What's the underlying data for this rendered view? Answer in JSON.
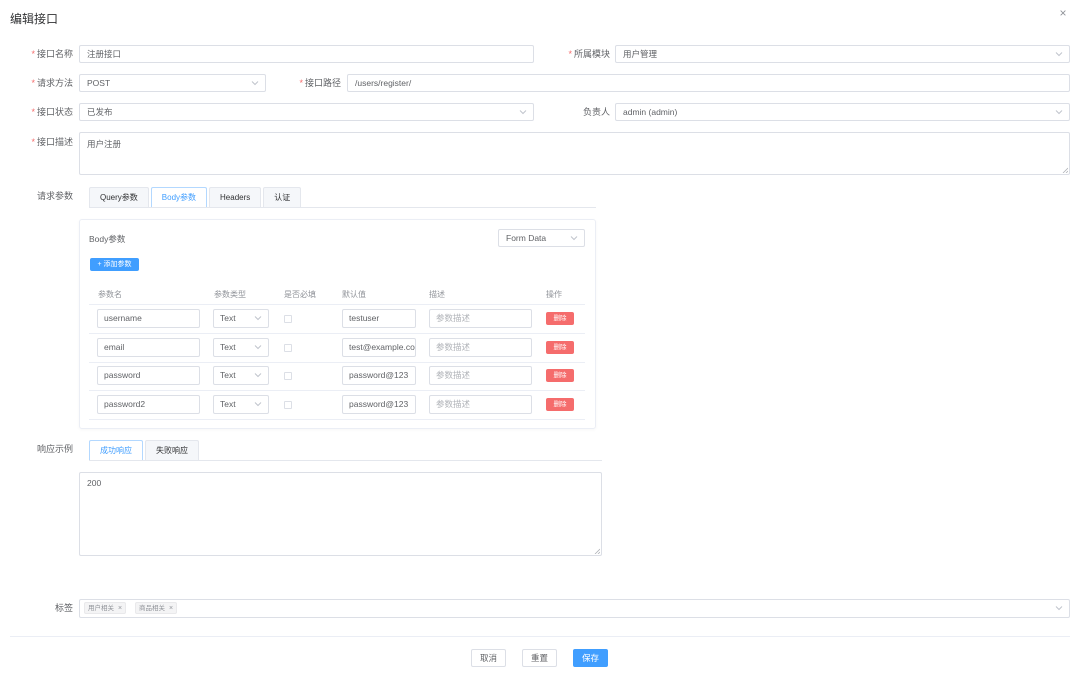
{
  "dialog": {
    "title": "编辑接口",
    "close": "×"
  },
  "form": {
    "name": {
      "label": "接口名称",
      "value": "注册接口"
    },
    "module": {
      "label": "所属模块",
      "value": "用户管理"
    },
    "method": {
      "label": "请求方法",
      "value": "POST"
    },
    "path": {
      "label": "接口路径",
      "value": "/users/register/"
    },
    "status": {
      "label": "接口状态",
      "value": "已发布"
    },
    "owner": {
      "label": "负责人",
      "value": "admin (admin)"
    },
    "desc": {
      "label": "接口描述",
      "value": "用户注册"
    }
  },
  "request": {
    "label": "请求参数",
    "tabs": [
      "Query参数",
      "Body参数",
      "Headers",
      "认证"
    ],
    "active_tab": 1,
    "body": {
      "title": "Body参数",
      "format": "Form Data",
      "add_label": "+ 添加参数",
      "columns": [
        "参数名",
        "参数类型",
        "是否必填",
        "默认值",
        "描述",
        "操作"
      ],
      "rows": [
        {
          "name": "username",
          "type": "Text",
          "default": "testuser",
          "desc_placeholder": "参数描述",
          "action": "删除"
        },
        {
          "name": "email",
          "type": "Text",
          "default": "test@example.com",
          "desc_placeholder": "参数描述",
          "action": "删除"
        },
        {
          "name": "password",
          "type": "Text",
          "default": "password@123",
          "desc_placeholder": "参数描述",
          "action": "删除"
        },
        {
          "name": "password2",
          "type": "Text",
          "default": "password@123",
          "desc_placeholder": "参数描述",
          "action": "删除"
        }
      ]
    }
  },
  "response": {
    "label": "响应示例",
    "tabs": [
      "成功响应",
      "失败响应"
    ],
    "active_tab": 0,
    "content": "200"
  },
  "tags": {
    "label": "标签",
    "items": [
      "用户相关",
      "商品相关"
    ]
  },
  "footer": {
    "cancel": "取消",
    "reset": "重置",
    "save": "保存"
  },
  "colors": {
    "primary": "#409eff",
    "danger": "#f56c6c",
    "border": "#dcdfe6"
  }
}
